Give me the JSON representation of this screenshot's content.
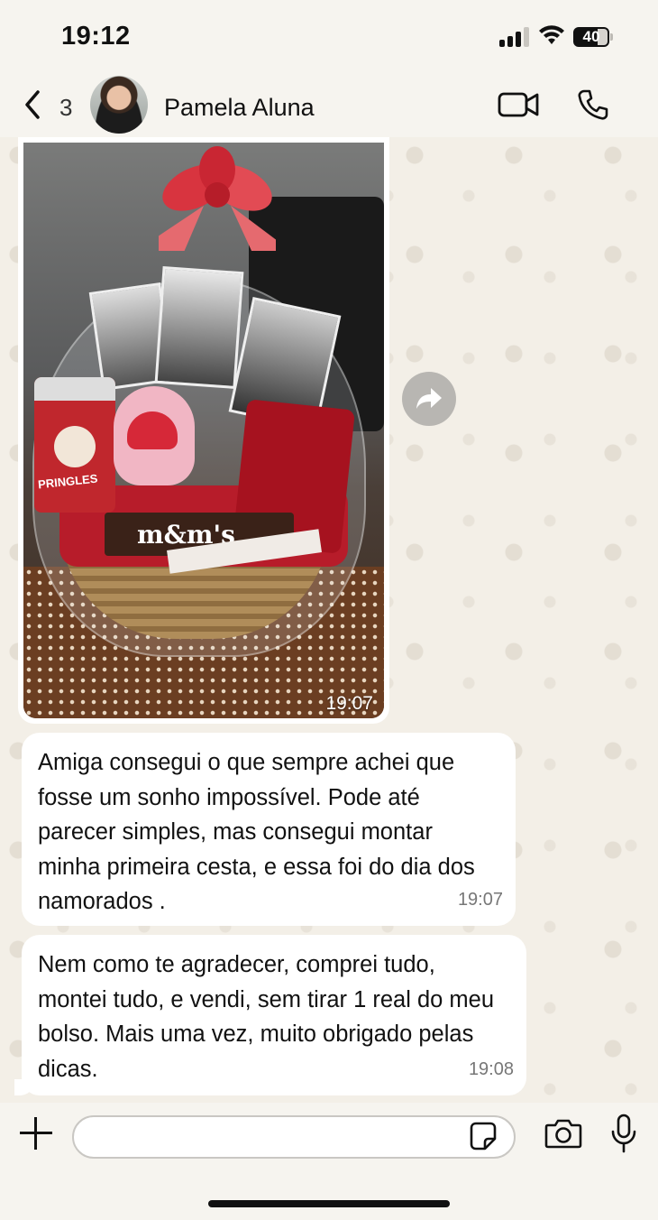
{
  "status_bar": {
    "time": "19:12",
    "battery": "40"
  },
  "header": {
    "back_count": "3",
    "contact_name": "Pamela Aluna"
  },
  "messages": [
    {
      "type": "image",
      "time": "19:07"
    },
    {
      "type": "text",
      "text": "Amiga consegui o que sempre achei que fosse um sonho impossível. Pode até parecer simples, mas consegui montar minha primeira cesta, e essa foi do dia dos namorados .",
      "time": "19:07"
    },
    {
      "type": "text",
      "text": "Nem como te agradecer, comprei tudo, montei tudo, e vendi, sem tirar 1 real do meu bolso. Mais uma vez, muito obrigado pelas dicas.",
      "time": "19:08"
    }
  ],
  "photo_labels": {
    "brand_1": "PRINGLES",
    "brand_2": "m&m's"
  },
  "composer": {
    "placeholder": ""
  },
  "colors": {
    "wallpaper": "#f3efe7",
    "bubble": "#ffffff",
    "bar": "#f6f4ef"
  }
}
